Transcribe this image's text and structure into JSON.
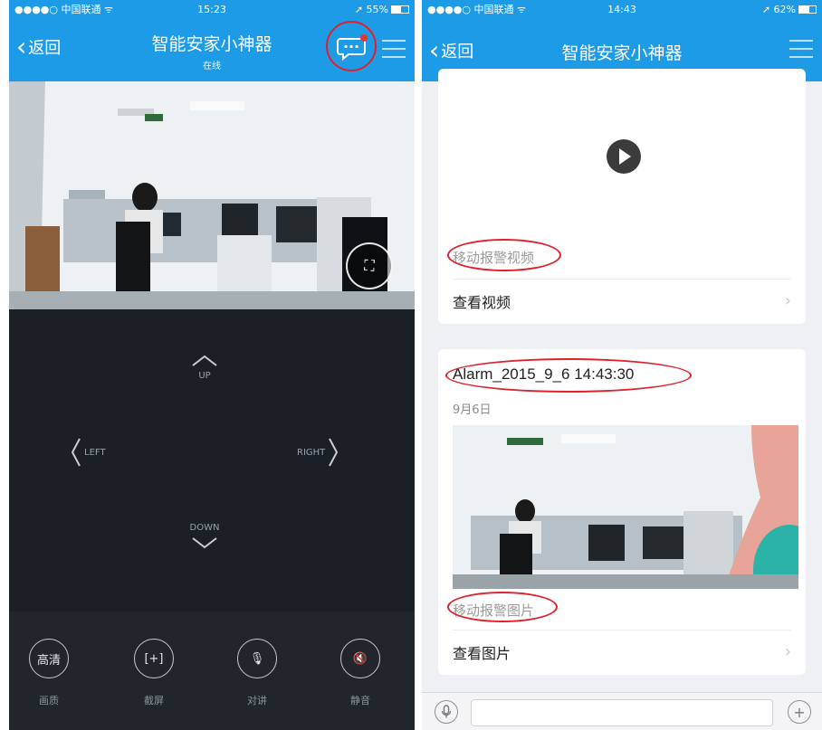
{
  "left": {
    "status": {
      "carrier": "●●●●○ 中国联通 ᯤ",
      "time": "15:23",
      "battery": "➚ 55%",
      "battery_level": 0.55
    },
    "nav": {
      "back": "返回",
      "title": "智能安家小神器",
      "subtitle": "在线"
    },
    "icons": {
      "back": "chevron-left-icon",
      "chat": "chat-bubble-icon",
      "menu": "hamburger-menu-icon",
      "fullscreen": "fullscreen-icon"
    },
    "ptz": {
      "up": "UP",
      "left": "LEFT",
      "right": "RIGHT",
      "down": "DOWN"
    },
    "controls": [
      {
        "label": "画质",
        "icon_text": "高清",
        "icon": "quality-icon"
      },
      {
        "label": "截屏",
        "icon_text": "[+]",
        "icon": "screenshot-icon"
      },
      {
        "label": "对讲",
        "icon_text": "🎙",
        "icon": "microphone-icon"
      },
      {
        "label": "静音",
        "icon_text": "🔇",
        "icon": "mute-icon"
      }
    ]
  },
  "right": {
    "status": {
      "carrier": "●●●●○ 中国联通 ᯤ",
      "time": "14:43",
      "battery": "➚ 62%",
      "battery_level": 0.62
    },
    "nav": {
      "back": "返回",
      "title": "智能安家小神器"
    },
    "video_card": {
      "caption": "移动报警视频",
      "action": "查看视频"
    },
    "image_card": {
      "title": "Alarm_2015_9_6 14:43:30",
      "date": "9月6日",
      "caption": "移动报警图片",
      "action": "查看图片"
    },
    "input_bar": {
      "voice_icon": "microphone-icon",
      "add_icon": "plus-icon"
    }
  },
  "colors": {
    "nav_blue": "#1e9be6",
    "dark_panel": "#1b2026",
    "highlight_red": "#e0202a"
  }
}
